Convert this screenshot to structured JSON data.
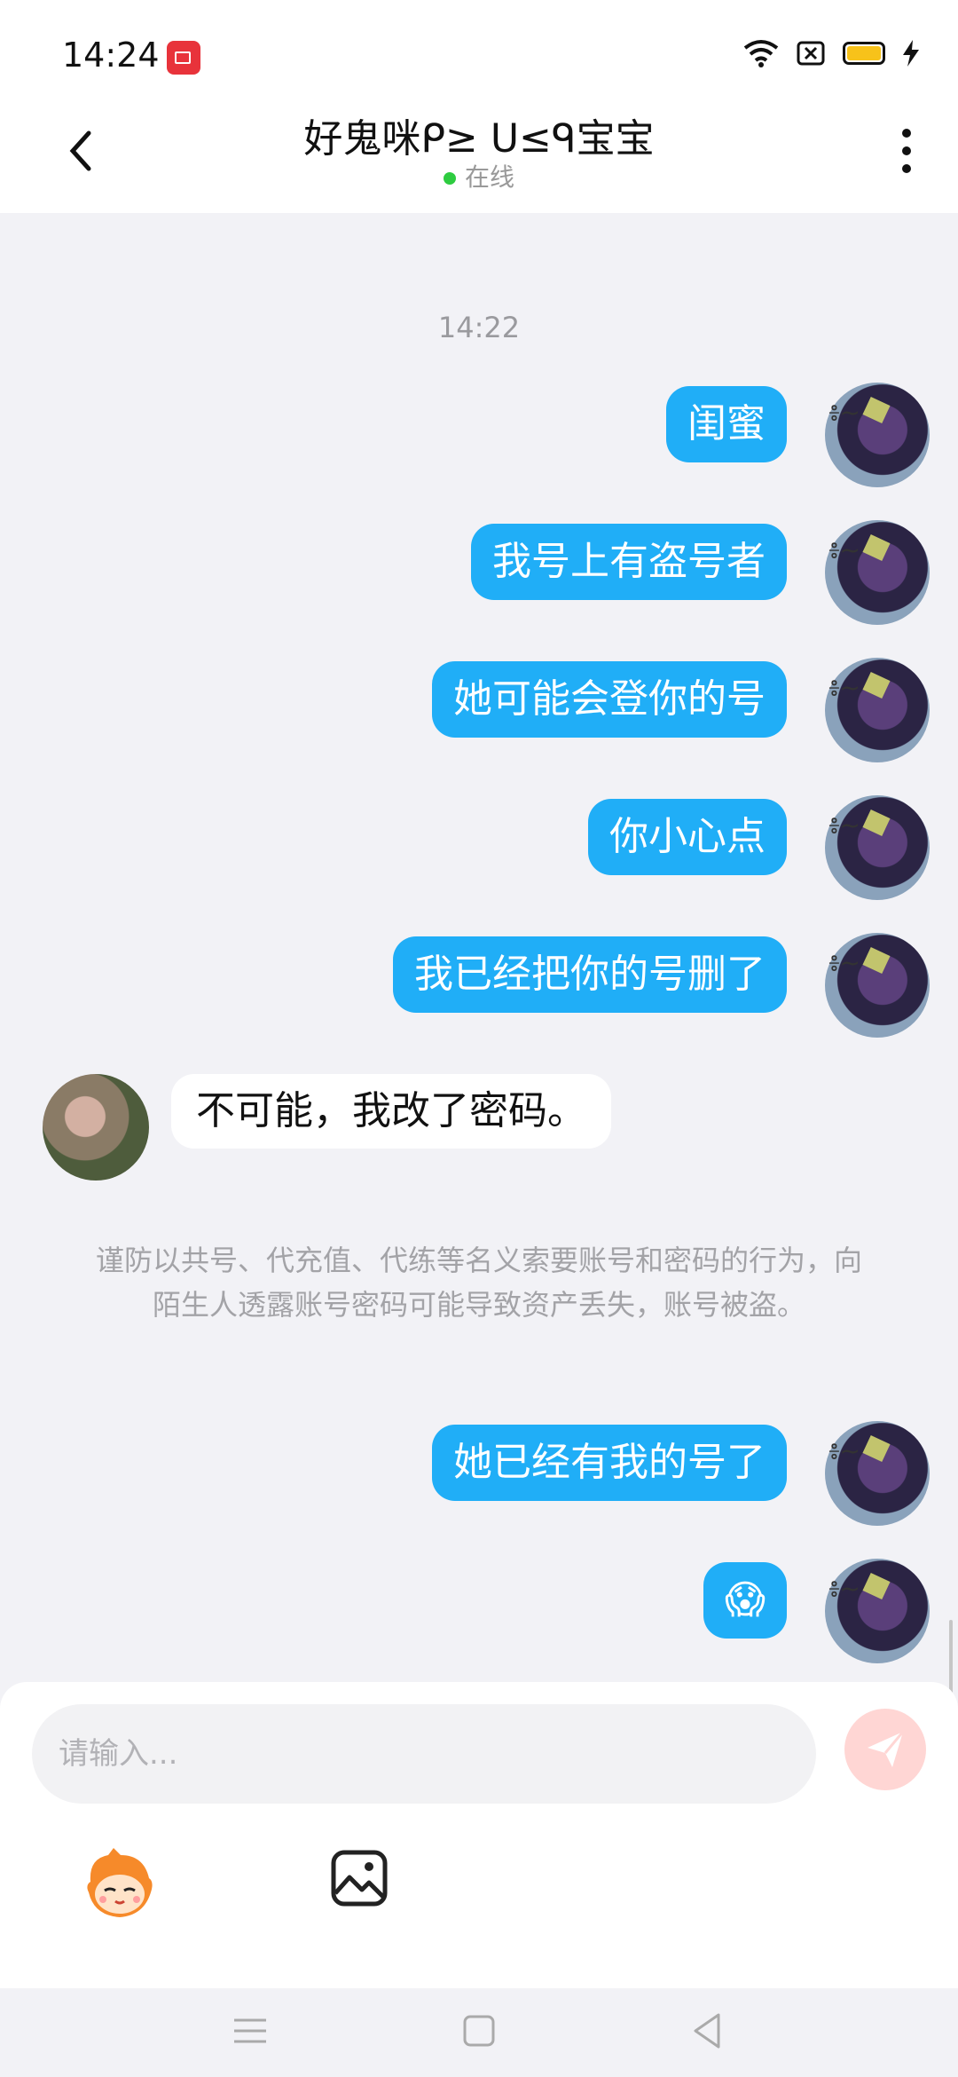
{
  "status_bar": {
    "time": "14:24"
  },
  "header": {
    "title": "好鬼咪ᑭ≥ ᑌ≤ᑫ宝宝",
    "status": "在线"
  },
  "chat": {
    "timestamp": "14:22",
    "outgoing_1": "闺蜜",
    "outgoing_2": "我号上有盗号者",
    "outgoing_3": "她可能会登你的号",
    "outgoing_4": "你小心点",
    "outgoing_5": "我已经把你的号删了",
    "incoming_1": "不可能，我改了密码。",
    "warning": "谨防以共号、代充值、代练等名义索要账号和密码的行为，向陌生人透露账号密码可能导致资产丢失，账号被盗。",
    "outgoing_6": "她已经有我的号了",
    "outgoing_7": "😱",
    "avatar_badge": "៖~"
  },
  "input": {
    "placeholder": "请输入..."
  },
  "colors": {
    "bubble_out": "#20aef7",
    "send": "#ffd6d4",
    "online": "#2ecc40"
  }
}
